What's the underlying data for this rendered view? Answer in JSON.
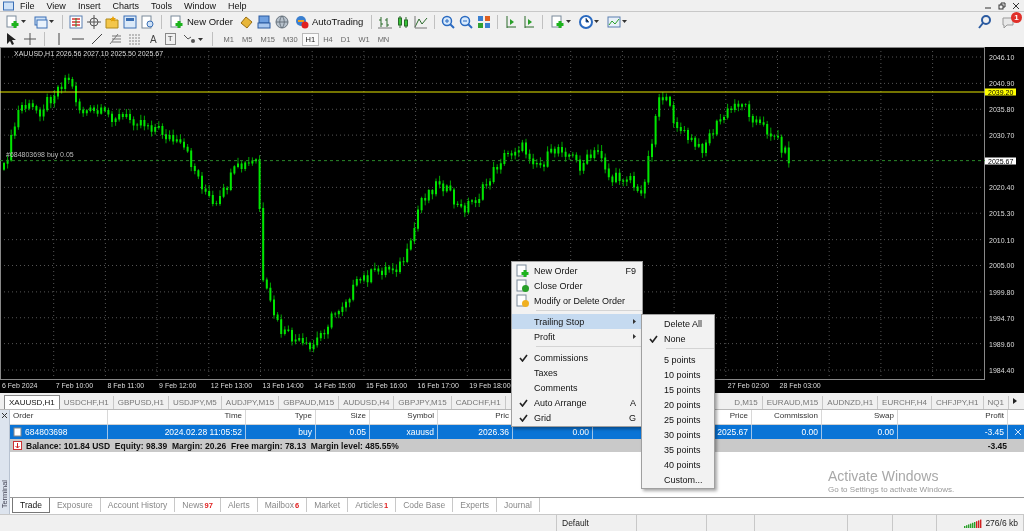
{
  "menu": [
    "File",
    "View",
    "Insert",
    "Charts",
    "Tools",
    "Window",
    "Help"
  ],
  "toolbar": {
    "new_order": "New Order",
    "auto_trading": "AutoTrading",
    "notification_count": "1"
  },
  "drawing_tools": {
    "text_tool": "A",
    "label_tool": "T"
  },
  "timeframes": [
    {
      "label": "M1",
      "selected": false
    },
    {
      "label": "M5",
      "selected": false
    },
    {
      "label": "M15",
      "selected": false
    },
    {
      "label": "M30",
      "selected": false
    },
    {
      "label": "H1",
      "selected": true
    },
    {
      "label": "H4",
      "selected": false
    },
    {
      "label": "D1",
      "selected": false
    },
    {
      "label": "W1",
      "selected": false
    },
    {
      "label": "MN",
      "selected": false
    }
  ],
  "chart": {
    "header": "XAUUSD,H1  2026.56 2027.10 2025.50 2025.67",
    "order_line_label": "#684803698 buy 0.05",
    "level_label": "2039.20",
    "bid_label": "2025.67",
    "price_labels": [
      "2046.10",
      "2040.90",
      "2035.80",
      "2030.70",
      "2020.40",
      "2015.30",
      "2010.10",
      "2005.00",
      "1999.80",
      "1994.70",
      "1989.60",
      "1984.40"
    ],
    "time_labels": [
      "6 Feb 2024",
      "7 Feb 10:00",
      "8 Feb 11:00",
      "9 Feb 12:00",
      "12 Feb 13:00",
      "13 Feb 14:00",
      "14 Feb 15:00",
      "15 Feb 16:00",
      "16 Feb 17:00",
      "19 Feb 18:00",
      "27 Feb 02:00",
      "28 Feb 03:00"
    ]
  },
  "chart_tabs": [
    {
      "label": "XAUUSD,H1",
      "selected": true
    },
    {
      "label": "USDCHF,H1",
      "selected": false
    },
    {
      "label": "GBPUSD,H1",
      "selected": false
    },
    {
      "label": "USDJPY,M5",
      "selected": false
    },
    {
      "label": "AUDJPY,M15",
      "selected": false
    },
    {
      "label": "GBPAUD,M15",
      "selected": false
    },
    {
      "label": "AUDUSD,H4",
      "selected": false
    },
    {
      "label": "GBPJPY,M15",
      "selected": false
    },
    {
      "label": "CADCHF,H1",
      "selected": false
    },
    {
      "label": "D,M15",
      "selected": false
    },
    {
      "label": "EURAUD,M15",
      "selected": false
    },
    {
      "label": "AUDNZD,H1",
      "selected": false
    },
    {
      "label": "EURCHF,H4",
      "selected": false
    },
    {
      "label": "CHFJPY,H1",
      "selected": false
    },
    {
      "label": "NQ1",
      "selected": false
    }
  ],
  "terminal": {
    "side_label": "Terminal",
    "columns": [
      "Order",
      "Time",
      "Type",
      "Size",
      "Symbol",
      "Pric",
      "Price",
      "Commission",
      "Swap",
      "Profit"
    ],
    "row": {
      "selected": true,
      "cells": [
        "684803698",
        "2024.02.28 11:05:52",
        "buy",
        "0.05",
        "xauusd",
        "2026.36",
        "0.00",
        "2025.67",
        "0.00",
        "0.00",
        "-3.45"
      ]
    },
    "summary": "Balance: 101.84 USD  Equity: 98.39  Margin: 20.26  Free margin: 78.13  Margin level: 485.55%",
    "summary_profit": "-3.45",
    "tabs": [
      {
        "label": "Trade",
        "selected": true
      },
      {
        "label": "Exposure",
        "selected": false
      },
      {
        "label": "Account History",
        "selected": false
      },
      {
        "label": "News",
        "badge": "97",
        "selected": false
      },
      {
        "label": "Alerts",
        "selected": false
      },
      {
        "label": "Mailbox",
        "badge": "6",
        "selected": false
      },
      {
        "label": "Market",
        "selected": false
      },
      {
        "label": "Articles",
        "badge": "1",
        "selected": false
      },
      {
        "label": "Code Base",
        "selected": false
      },
      {
        "label": "Experts",
        "selected": false
      },
      {
        "label": "Journal",
        "selected": false
      }
    ]
  },
  "context_menu": {
    "items": [
      {
        "kind": "item",
        "label": "New Order",
        "shortcut": "F9",
        "checked": false,
        "submenu": false,
        "selected": false
      },
      {
        "kind": "item",
        "label": "Close Order",
        "checked": false,
        "submenu": false,
        "selected": false
      },
      {
        "kind": "item",
        "label": "Modify or Delete Order",
        "checked": false,
        "submenu": false,
        "selected": false
      },
      {
        "kind": "separator"
      },
      {
        "kind": "item",
        "label": "Trailing Stop",
        "checked": false,
        "submenu": true,
        "selected": true
      },
      {
        "kind": "item",
        "label": "Profit",
        "checked": false,
        "submenu": true,
        "selected": false
      },
      {
        "kind": "separator"
      },
      {
        "kind": "item",
        "label": "Commissions",
        "checked": true,
        "submenu": false,
        "selected": false
      },
      {
        "kind": "item",
        "label": "Taxes",
        "checked": false,
        "submenu": false,
        "selected": false
      },
      {
        "kind": "item",
        "label": "Comments",
        "checked": false,
        "submenu": false,
        "selected": false
      },
      {
        "kind": "item",
        "label": "Auto Arrange",
        "shortcut": "A",
        "checked": true,
        "submenu": false,
        "selected": false
      },
      {
        "kind": "item",
        "label": "Grid",
        "shortcut": "G",
        "checked": true,
        "submenu": false,
        "selected": false
      }
    ]
  },
  "submenu": {
    "items": [
      {
        "kind": "item",
        "label": "Delete All",
        "checked": false
      },
      {
        "kind": "item",
        "label": "None",
        "checked": true
      },
      {
        "kind": "separator"
      },
      {
        "kind": "item",
        "label": "5 points",
        "checked": false
      },
      {
        "kind": "item",
        "label": "10 points",
        "checked": false
      },
      {
        "kind": "item",
        "label": "15 points",
        "checked": false
      },
      {
        "kind": "item",
        "label": "20 points",
        "checked": false
      },
      {
        "kind": "item",
        "label": "25 points",
        "checked": false
      },
      {
        "kind": "item",
        "label": "30 points",
        "checked": false
      },
      {
        "kind": "item",
        "label": "35 points",
        "checked": false
      },
      {
        "kind": "item",
        "label": "40 points",
        "checked": false
      },
      {
        "kind": "item",
        "label": "Custom...",
        "checked": false
      }
    ]
  },
  "activation_notice": {
    "title": "Activate Windows",
    "hint": "Go to Settings to activate Windows."
  },
  "status_bar": {
    "profile": "Default",
    "traffic": "276/6 kb"
  }
}
